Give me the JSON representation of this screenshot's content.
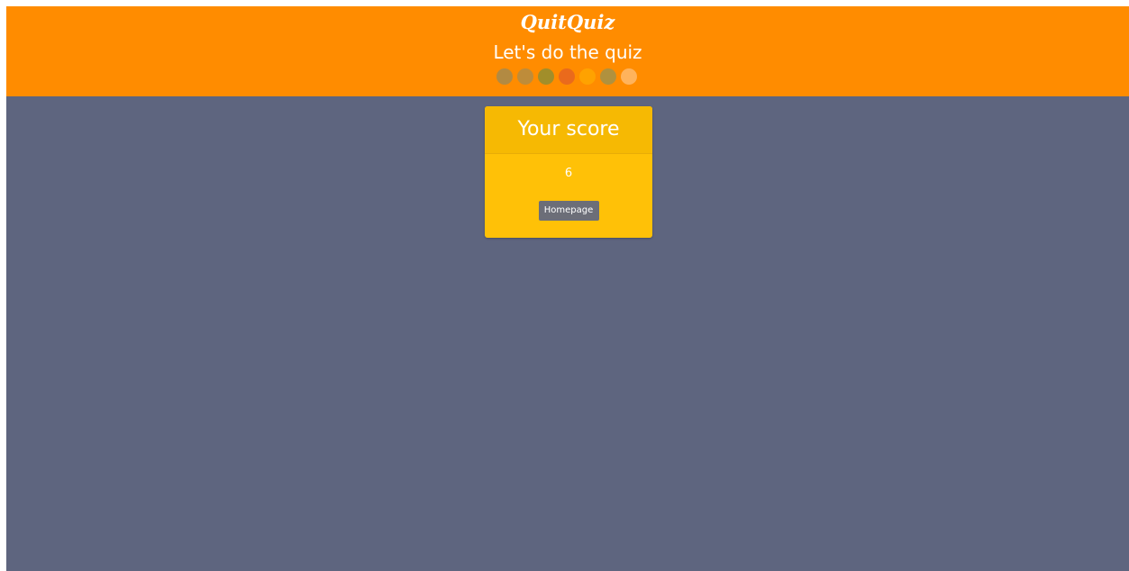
{
  "header": {
    "brand": "QuitQuiz",
    "subtitle": "Let's do the quiz",
    "progress_dots": [
      {
        "color": "#b28a42"
      },
      {
        "color": "#be8c3a"
      },
      {
        "color": "#a18e2a"
      },
      {
        "color": "#ea6a1c"
      },
      {
        "color": "#ffa200"
      },
      {
        "color": "#b0913e"
      },
      {
        "color": "#ffb35c"
      }
    ],
    "background": "#ff8c00"
  },
  "result_card": {
    "title": "Your score",
    "score": "6",
    "homepage_button": "Homepage",
    "background": "#ffc107"
  },
  "page": {
    "background": "#5e657f"
  }
}
